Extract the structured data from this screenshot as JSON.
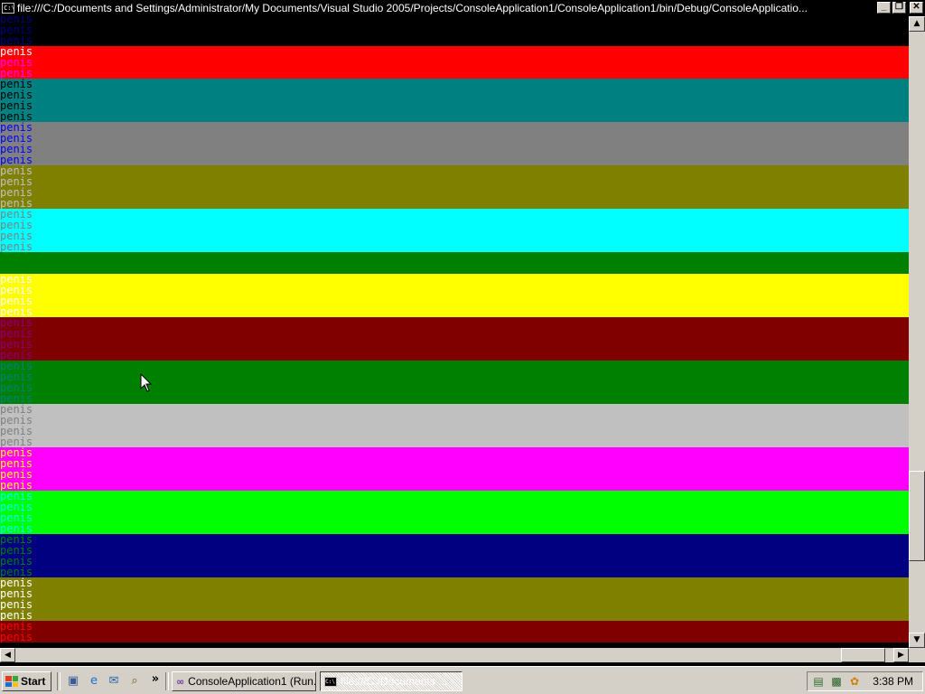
{
  "window": {
    "icon": "console-icon",
    "title": "file:///C:/Documents and Settings/Administrator/My Documents/Visual Studio 2005/Projects/ConsoleApplication1/ConsoleApplication1/bin/Debug/ConsoleApplicatio...",
    "minimize_label": "_",
    "restore_label": "❐",
    "close_label": "✕"
  },
  "console": {
    "word": "penis",
    "rows": [
      {
        "bg": "#000000",
        "fg": "#000080"
      },
      {
        "bg": "#000000",
        "fg": "#000080"
      },
      {
        "bg": "#000000",
        "fg": "#000080"
      },
      {
        "bg": "#ff0000",
        "fg": "#ffffff"
      },
      {
        "bg": "#ff0000",
        "fg": "#ff00ff"
      },
      {
        "bg": "#ff0000",
        "fg": "#ff00ff"
      },
      {
        "bg": "#008080",
        "fg": "#000000"
      },
      {
        "bg": "#008080",
        "fg": "#000000"
      },
      {
        "bg": "#008080",
        "fg": "#000000"
      },
      {
        "bg": "#008080",
        "fg": "#000000"
      },
      {
        "bg": "#808080",
        "fg": "#0000ff"
      },
      {
        "bg": "#808080",
        "fg": "#0000ff"
      },
      {
        "bg": "#808080",
        "fg": "#0000ff"
      },
      {
        "bg": "#808080",
        "fg": "#0000ff"
      },
      {
        "bg": "#808000",
        "fg": "#c0c0c0"
      },
      {
        "bg": "#808000",
        "fg": "#c0c0c0"
      },
      {
        "bg": "#808000",
        "fg": "#c0c0c0"
      },
      {
        "bg": "#808000",
        "fg": "#c0c0c0"
      },
      {
        "bg": "#00ffff",
        "fg": "#808080"
      },
      {
        "bg": "#00ffff",
        "fg": "#808080"
      },
      {
        "bg": "#00ffff",
        "fg": "#808080"
      },
      {
        "bg": "#00ffff",
        "fg": "#808080"
      },
      {
        "bg": "#008000",
        "fg": "#008000"
      },
      {
        "bg": "#008000",
        "fg": "#008000"
      },
      {
        "bg": "#ffff00",
        "fg": "#ffffff"
      },
      {
        "bg": "#ffff00",
        "fg": "#ffffff"
      },
      {
        "bg": "#ffff00",
        "fg": "#ffffff"
      },
      {
        "bg": "#ffff00",
        "fg": "#ffffff"
      },
      {
        "bg": "#800000",
        "fg": "#800080"
      },
      {
        "bg": "#800000",
        "fg": "#800080"
      },
      {
        "bg": "#800000",
        "fg": "#800080"
      },
      {
        "bg": "#800000",
        "fg": "#800080"
      },
      {
        "bg": "#008000",
        "fg": "#008080"
      },
      {
        "bg": "#008000",
        "fg": "#008080"
      },
      {
        "bg": "#008000",
        "fg": "#008080"
      },
      {
        "bg": "#008000",
        "fg": "#008080"
      },
      {
        "bg": "#c0c0c0",
        "fg": "#808080"
      },
      {
        "bg": "#c0c0c0",
        "fg": "#808080"
      },
      {
        "bg": "#c0c0c0",
        "fg": "#808080"
      },
      {
        "bg": "#c0c0c0",
        "fg": "#808080"
      },
      {
        "bg": "#ff00ff",
        "fg": "#ffff00"
      },
      {
        "bg": "#ff00ff",
        "fg": "#ffff00"
      },
      {
        "bg": "#ff00ff",
        "fg": "#ffff00"
      },
      {
        "bg": "#ff00ff",
        "fg": "#ffff00"
      },
      {
        "bg": "#00ff00",
        "fg": "#00ffff"
      },
      {
        "bg": "#00ff00",
        "fg": "#00ffff"
      },
      {
        "bg": "#00ff00",
        "fg": "#00ffff"
      },
      {
        "bg": "#00ff00",
        "fg": "#00ffff"
      },
      {
        "bg": "#000080",
        "fg": "#008000"
      },
      {
        "bg": "#000080",
        "fg": "#008000"
      },
      {
        "bg": "#000080",
        "fg": "#008000"
      },
      {
        "bg": "#000080",
        "fg": "#008000"
      },
      {
        "bg": "#808000",
        "fg": "#ffffff"
      },
      {
        "bg": "#808000",
        "fg": "#ffffff"
      },
      {
        "bg": "#808000",
        "fg": "#ffffff"
      },
      {
        "bg": "#808000",
        "fg": "#ffffff"
      },
      {
        "bg": "#800000",
        "fg": "#ff0000"
      },
      {
        "bg": "#800000",
        "fg": "#ff0000"
      }
    ]
  },
  "scrollbar": {
    "up_icon": "▲",
    "down_icon": "▼",
    "left_icon": "◀",
    "right_icon": "▶",
    "vertical_position": 0.86,
    "vertical_visible_fraction": 0.15,
    "horizontal_position": 0.99,
    "horizontal_visible_fraction": 0.05
  },
  "taskbar": {
    "start_label": "Start",
    "quick_launch": [
      "desktop-icon",
      "ie-icon",
      "outlook-icon",
      "search-icon"
    ],
    "more_label": "»",
    "tasks": [
      {
        "label": "ConsoleApplication1 (Run...",
        "icon": "visual-studio-icon",
        "active": false
      },
      {
        "label": "file:///C:/Documents ...",
        "icon": "console-icon",
        "active": true
      }
    ],
    "tray_icons": [
      "network-icon",
      "vmware-icon",
      "messenger-icon"
    ],
    "clock": "3:38 PM"
  }
}
